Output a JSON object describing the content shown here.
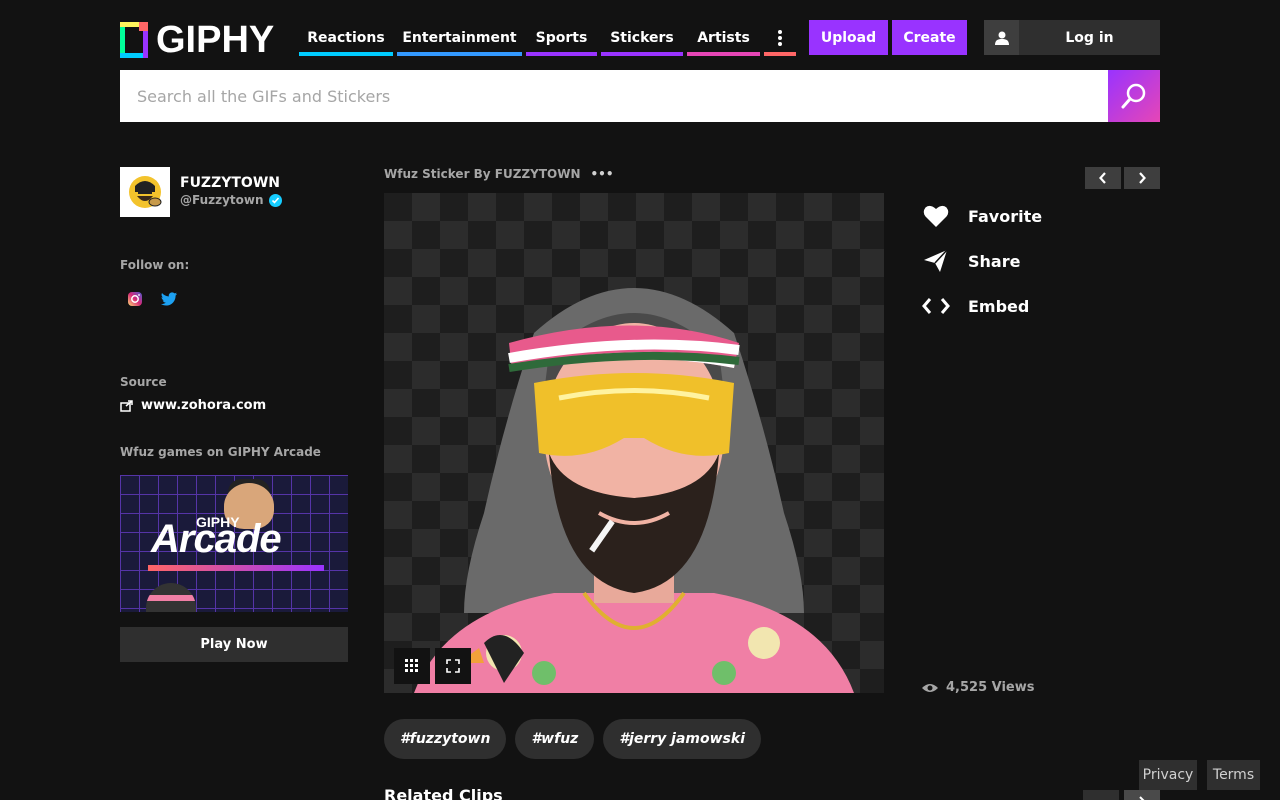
{
  "header": {
    "logo_text": "GIPHY",
    "nav": [
      {
        "label": "Reactions",
        "color": "#00ccff"
      },
      {
        "label": "Entertainment",
        "color": "#3399ff"
      },
      {
        "label": "Sports",
        "color": "#9933ff"
      },
      {
        "label": "Stickers",
        "color": "#9933ff"
      },
      {
        "label": "Artists",
        "color": "#e646b6"
      }
    ],
    "more_bar_color": "#ff6666",
    "upload_label": "Upload",
    "create_label": "Create",
    "login_label": "Log in"
  },
  "search": {
    "placeholder": "Search all the GIFs and Stickers"
  },
  "profile": {
    "name": "FUZZYTOWN",
    "handle": "@Fuzzytown",
    "follow_label": "Follow on:",
    "social": [
      "instagram-icon",
      "twitter-icon"
    ],
    "source_label": "Source",
    "source_url": "www.zohora.com",
    "arcade_label": "Wfuz games on GIPHY Arcade",
    "arcade_giphy": "GIPHY",
    "arcade_title": "Arcade",
    "play_label": "Play Now"
  },
  "sticker": {
    "title": "Wfuz Sticker By FUZZYTOWN",
    "more": "•••"
  },
  "actions": {
    "favorite": "Favorite",
    "share": "Share",
    "embed": "Embed",
    "views": "4,525 Views"
  },
  "tags": [
    "#fuzzytown",
    "#wfuz",
    "#jerry jamowski"
  ],
  "related_title": "Related Clips",
  "footer": {
    "privacy": "Privacy",
    "terms": "Terms"
  },
  "colors": {
    "background": "#121212",
    "accent_purple": "#9933ff",
    "accent_pink": "#e646b6",
    "verified_blue": "#15cdff"
  }
}
